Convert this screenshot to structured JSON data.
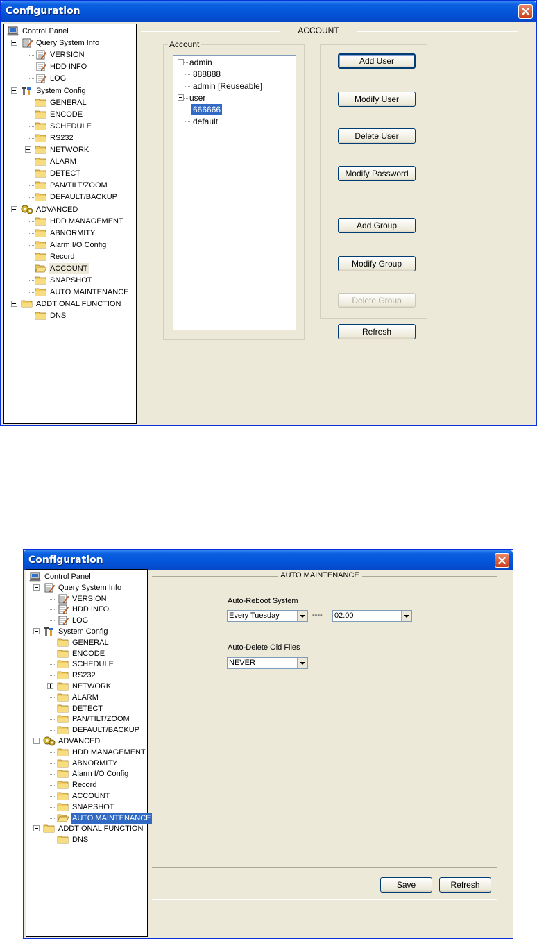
{
  "window1": {
    "title": "Configuration",
    "tree": [
      {
        "label": "Control Panel",
        "icon": "computer-icon"
      },
      {
        "label": "Query System Info",
        "icon": "notepad-icon"
      },
      {
        "label": "VERSION",
        "icon": "notepad-icon"
      },
      {
        "label": "HDD INFO",
        "icon": "notepad-icon"
      },
      {
        "label": "LOG",
        "icon": "notepad-icon"
      },
      {
        "label": "System Config",
        "icon": "tools-icon"
      },
      {
        "label": "GENERAL",
        "icon": "folder-icon"
      },
      {
        "label": "ENCODE",
        "icon": "folder-icon"
      },
      {
        "label": "SCHEDULE",
        "icon": "folder-icon"
      },
      {
        "label": "RS232",
        "icon": "folder-icon"
      },
      {
        "label": "NETWORK",
        "icon": "folder-icon"
      },
      {
        "label": "ALARM",
        "icon": "folder-icon"
      },
      {
        "label": "DETECT",
        "icon": "folder-icon"
      },
      {
        "label": "PAN/TILT/ZOOM",
        "icon": "folder-icon"
      },
      {
        "label": "DEFAULT/BACKUP",
        "icon": "folder-icon"
      },
      {
        "label": "ADVANCED",
        "icon": "gears-icon"
      },
      {
        "label": "HDD MANAGEMENT",
        "icon": "folder-icon"
      },
      {
        "label": "ABNORMITY",
        "icon": "folder-icon"
      },
      {
        "label": "Alarm I/O Config",
        "icon": "folder-icon"
      },
      {
        "label": "Record",
        "icon": "folder-icon"
      },
      {
        "label": "ACCOUNT",
        "icon": "folder-open-icon"
      },
      {
        "label": "SNAPSHOT",
        "icon": "folder-icon"
      },
      {
        "label": "AUTO MAINTENANCE",
        "icon": "folder-icon"
      },
      {
        "label": "ADDTIONAL FUNCTION",
        "icon": "folder-icon"
      },
      {
        "label": "DNS",
        "icon": "folder-icon"
      }
    ],
    "section_title": "ACCOUNT",
    "account_group_label": "Account",
    "account_tree": [
      "admin",
      "888888",
      "admin [Reuseable]",
      "user",
      "666666",
      "default"
    ],
    "buttons": {
      "add_user": "Add User",
      "modify_user": "Modify User",
      "delete_user": "Delete User",
      "modify_password": "Modify Password",
      "add_group": "Add Group",
      "modify_group": "Modify Group",
      "delete_group": "Delete Group",
      "refresh": "Refresh"
    }
  },
  "window2": {
    "title": "Configuration",
    "tree": [
      {
        "label": "Control Panel",
        "icon": "computer-icon"
      },
      {
        "label": "Query System Info",
        "icon": "notepad-icon"
      },
      {
        "label": "VERSION",
        "icon": "notepad-icon"
      },
      {
        "label": "HDD INFO",
        "icon": "notepad-icon"
      },
      {
        "label": "LOG",
        "icon": "notepad-icon"
      },
      {
        "label": "System Config",
        "icon": "tools-icon"
      },
      {
        "label": "GENERAL",
        "icon": "folder-icon"
      },
      {
        "label": "ENCODE",
        "icon": "folder-icon"
      },
      {
        "label": "SCHEDULE",
        "icon": "folder-icon"
      },
      {
        "label": "RS232",
        "icon": "folder-icon"
      },
      {
        "label": "NETWORK",
        "icon": "folder-icon"
      },
      {
        "label": "ALARM",
        "icon": "folder-icon"
      },
      {
        "label": "DETECT",
        "icon": "folder-icon"
      },
      {
        "label": "PAN/TILT/ZOOM",
        "icon": "folder-icon"
      },
      {
        "label": "DEFAULT/BACKUP",
        "icon": "folder-icon"
      },
      {
        "label": "ADVANCED",
        "icon": "gears-icon"
      },
      {
        "label": "HDD MANAGEMENT",
        "icon": "folder-icon"
      },
      {
        "label": "ABNORMITY",
        "icon": "folder-icon"
      },
      {
        "label": "Alarm I/O Config",
        "icon": "folder-icon"
      },
      {
        "label": "Record",
        "icon": "folder-icon"
      },
      {
        "label": "ACCOUNT",
        "icon": "folder-icon"
      },
      {
        "label": "SNAPSHOT",
        "icon": "folder-icon"
      },
      {
        "label": "AUTO MAINTENANCE",
        "icon": "folder-open-icon"
      },
      {
        "label": "ADDTIONAL FUNCTION",
        "icon": "folder-icon"
      },
      {
        "label": "DNS",
        "icon": "folder-icon"
      }
    ],
    "section_title": "AUTO MAINTENANCE",
    "auto_reboot": {
      "label": "Auto-Reboot System",
      "day_value": "Every Tuesday",
      "separator": "----",
      "time_value": "02:00"
    },
    "auto_delete": {
      "label": "Auto-Delete Old Files",
      "value": "NEVER"
    },
    "buttons": {
      "save": "Save",
      "refresh": "Refresh"
    }
  },
  "colors": {
    "title_bar": "#0454d8",
    "selection": "#316ac5",
    "face": "#ece9d8"
  }
}
